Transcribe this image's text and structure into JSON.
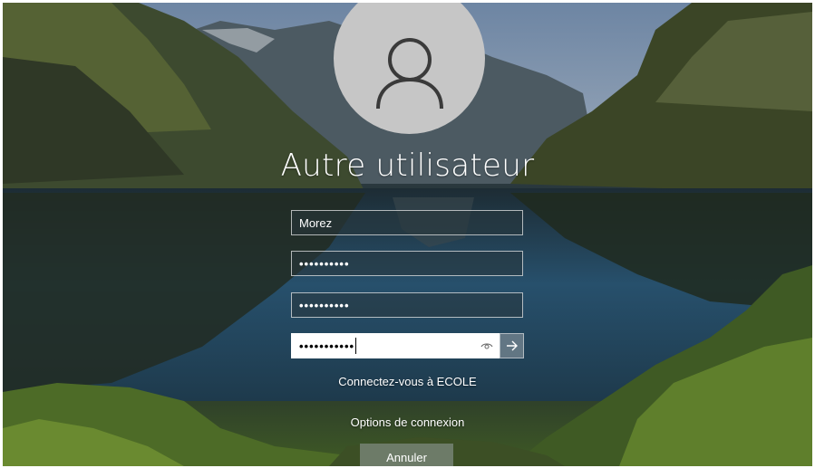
{
  "login": {
    "title": "Autre utilisateur",
    "username_value": "Morez",
    "password1_masked": "••••••••••",
    "password2_masked": "••••••••••",
    "password3_masked": "•••••••••••",
    "domain_text": "Connectez-vous à ECOLE",
    "options_link": "Options de connexion",
    "cancel_label": "Annuler"
  },
  "icons": {
    "avatar": "user-avatar-icon",
    "reveal": "eye-icon",
    "submit": "arrow-right-icon"
  },
  "colors": {
    "avatar_bg": "#c6c6c6",
    "text": "#ffffff",
    "active_field_bg": "#ffffff"
  }
}
